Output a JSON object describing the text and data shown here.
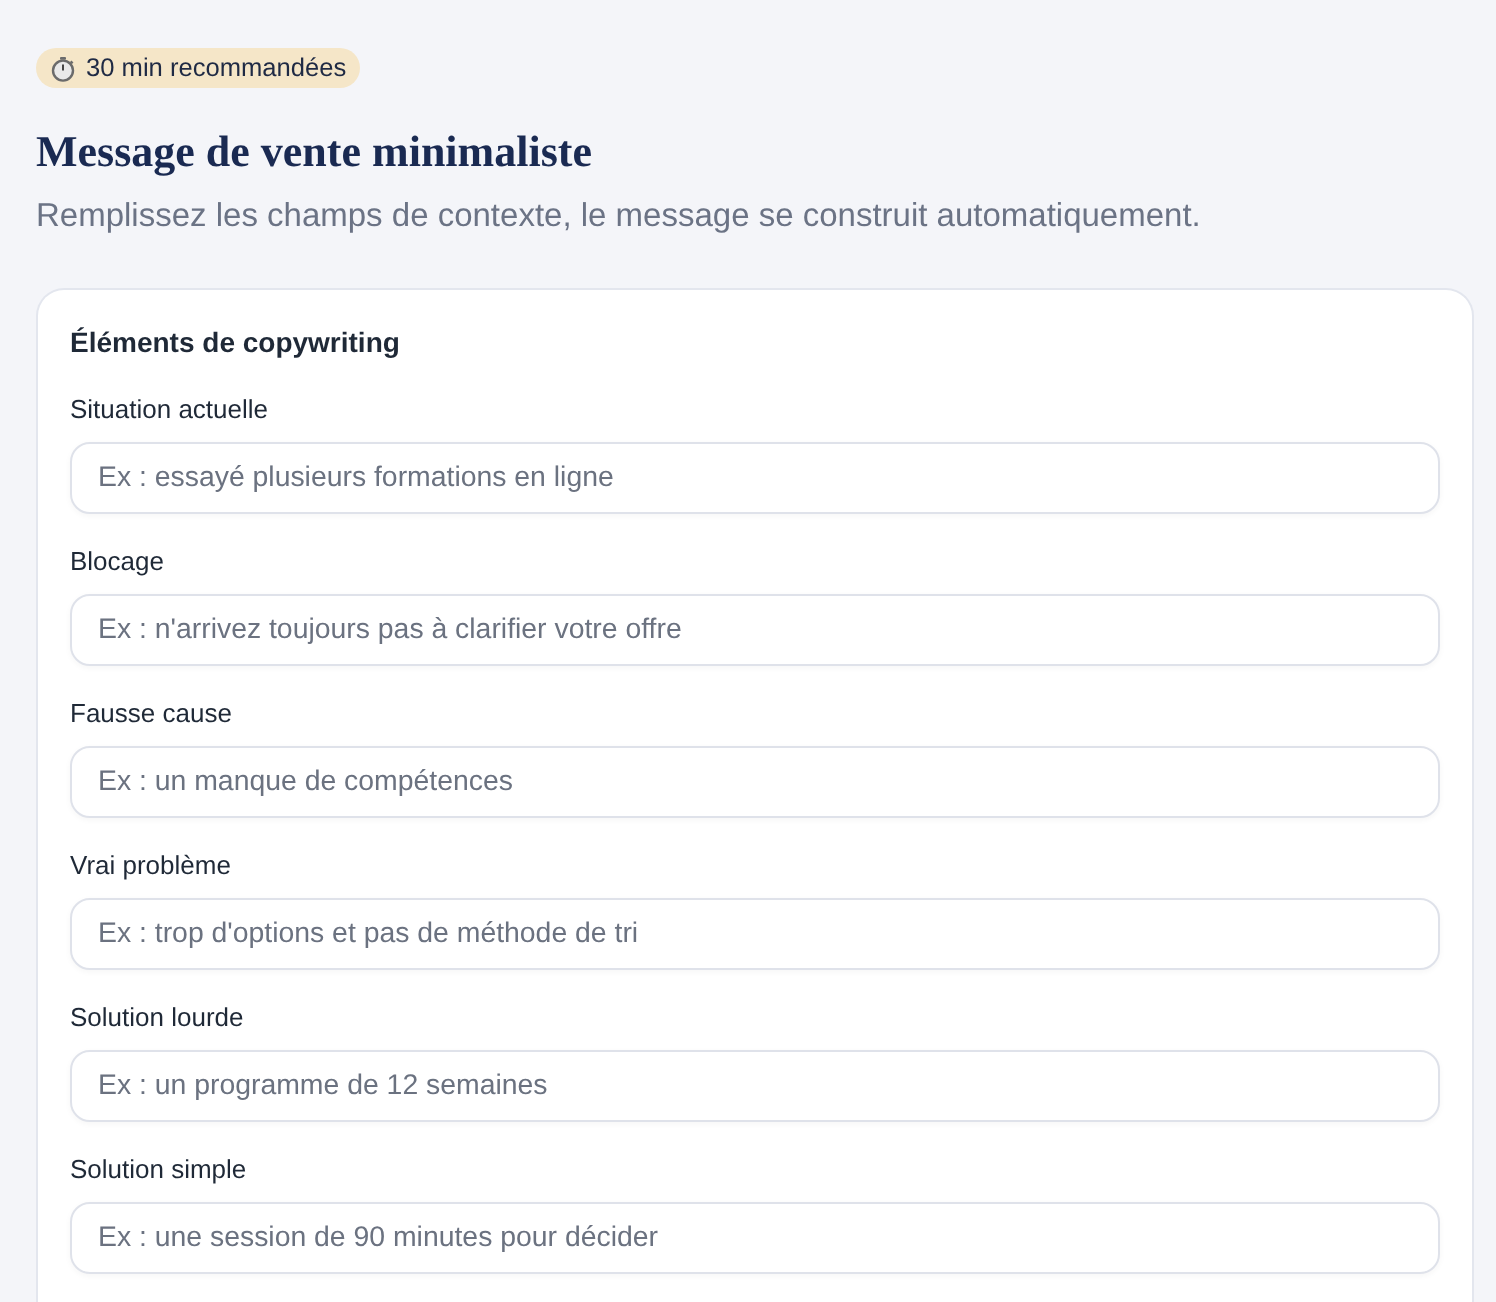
{
  "badge": {
    "text": "30 min recommandées"
  },
  "header": {
    "title": "Message de vente minimaliste",
    "subtitle": "Remplissez les champs de contexte, le message se construit automatiquement."
  },
  "card": {
    "title": "Éléments de copywriting",
    "fields": [
      {
        "label": "Situation actuelle",
        "placeholder": "Ex : essayé plusieurs formations en ligne"
      },
      {
        "label": "Blocage",
        "placeholder": "Ex : n'arrivez toujours pas à clarifier votre offre"
      },
      {
        "label": "Fausse cause",
        "placeholder": "Ex : un manque de compétences"
      },
      {
        "label": "Vrai problème",
        "placeholder": "Ex : trop d'options et pas de méthode de tri"
      },
      {
        "label": "Solution lourde",
        "placeholder": "Ex : un programme de 12 semaines"
      },
      {
        "label": "Solution simple",
        "placeholder": "Ex : une session de 90 minutes pour décider"
      }
    ]
  }
}
